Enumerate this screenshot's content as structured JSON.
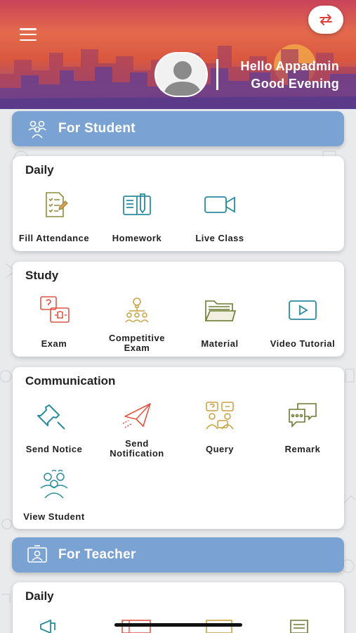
{
  "header": {
    "greeting_line1": "Hello Appadmin",
    "greeting_line2": "Good Evening",
    "menu_icon": "hamburger-icon",
    "swap_icon": "swap-arrows-icon",
    "avatar_icon": "user-avatar"
  },
  "student_section": {
    "title": "For Student",
    "daily": {
      "title": "Daily",
      "items": [
        {
          "label": "Fill Attendance",
          "icon": "attendance-icon"
        },
        {
          "label": "Homework",
          "icon": "homework-icon"
        },
        {
          "label": "Live Class",
          "icon": "video-camera-icon"
        }
      ]
    },
    "study": {
      "title": "Study",
      "items": [
        {
          "label": "Exam",
          "icon": "exam-icon"
        },
        {
          "label": "Competitive",
          "label2": "Exam",
          "icon": "competitive-exam-icon"
        },
        {
          "label": "Material",
          "icon": "folder-icon"
        },
        {
          "label": "Video Tutorial",
          "icon": "play-icon"
        }
      ]
    },
    "communication": {
      "title": "Communication",
      "items": [
        {
          "label": "Send Notice",
          "icon": "pushpin-icon"
        },
        {
          "label": "Send",
          "label2": "Notification",
          "icon": "paper-plane-icon"
        },
        {
          "label": "Query",
          "icon": "query-icon"
        },
        {
          "label": "Remark",
          "icon": "chat-bubbles-icon"
        },
        {
          "label": "View Student",
          "icon": "students-group-icon"
        }
      ]
    }
  },
  "teacher_section": {
    "title": "For Teacher",
    "daily": {
      "title": "Daily"
    }
  },
  "colors": {
    "banner": "#7aa3d3",
    "swap_icon": "#e0403a",
    "icon_teal": "#2a8ca0",
    "icon_olive": "#8c8c3a",
    "icon_red": "#e05545",
    "icon_gold": "#c9a040"
  }
}
